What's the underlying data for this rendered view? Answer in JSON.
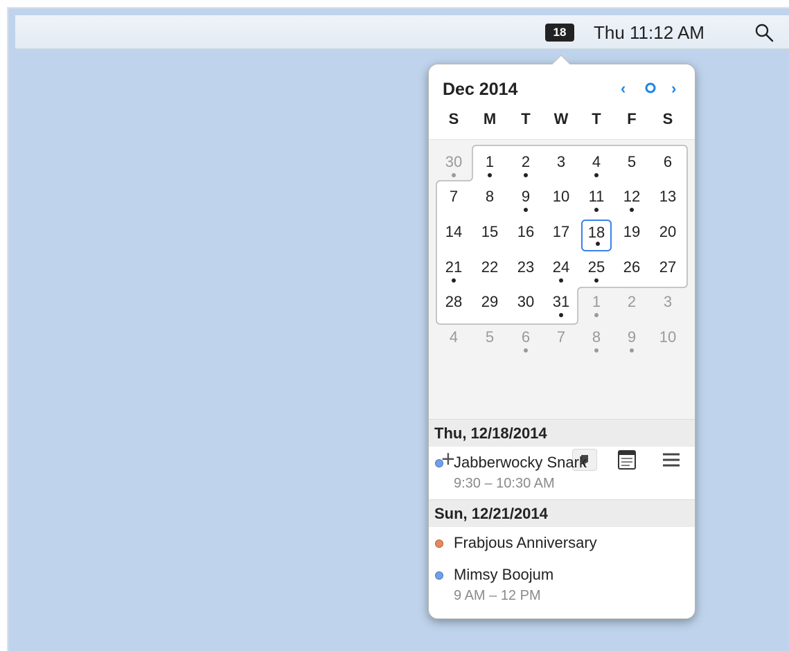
{
  "menubar": {
    "date_badge": "18",
    "clock": "Thu 11:12 AM",
    "search_icon": "magnifier-icon"
  },
  "calendar": {
    "month_title": "Dec 2014",
    "nav": {
      "prev": "‹",
      "today": "o",
      "next": "›"
    },
    "accent_color": "#1e86e6",
    "weekdays": [
      "S",
      "M",
      "T",
      "W",
      "T",
      "F",
      "S"
    ],
    "weeks": [
      [
        "30",
        "1",
        "2",
        "3",
        "4",
        "5",
        "6"
      ],
      [
        "7",
        "8",
        "9",
        "10",
        "11",
        "12",
        "13"
      ],
      [
        "14",
        "15",
        "16",
        "17",
        "18",
        "19",
        "20"
      ],
      [
        "21",
        "22",
        "23",
        "24",
        "25",
        "26",
        "27"
      ],
      [
        "28",
        "29",
        "30",
        "31",
        "1",
        "2",
        "3"
      ],
      [
        "4",
        "5",
        "6",
        "7",
        "8",
        "9",
        "10"
      ]
    ],
    "today": "18"
  },
  "toolbar": {
    "add_label": "+",
    "pin_icon": "pin-icon",
    "calendar_view_icon": "calendar-view-icon",
    "list_icon": "list-icon"
  },
  "agenda": [
    {
      "date": "Thu, 12/18/2014",
      "events": [
        {
          "title": "Jabberwocky Snark",
          "time": "9:30 – 10:30 AM",
          "color": "#6ea0f0"
        }
      ]
    },
    {
      "date": "Sun, 12/21/2014",
      "events": [
        {
          "title": "Frabjous Anniversary",
          "time": "",
          "color": "#e8885a"
        },
        {
          "title": "Mimsy Boojum",
          "time": "9 AM – 12 PM",
          "color": "#6ea0f0"
        }
      ]
    }
  ]
}
